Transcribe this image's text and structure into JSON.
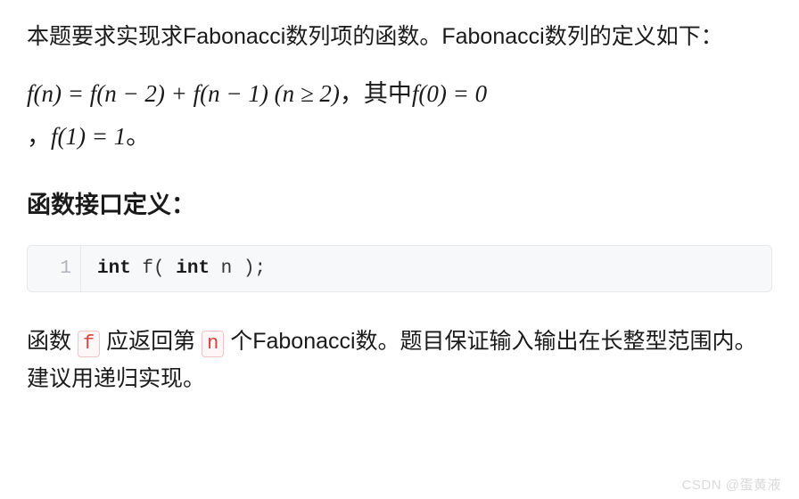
{
  "intro": "本题要求实现求Fabonacci数列项的函数。Fabonacci数列的定义如下：",
  "formula": {
    "line1_a": "f(n) = f(n − 2) + f(n − 1) (n ≥ 2)",
    "line1_b": "，其中",
    "line1_c": "f(0) = 0",
    "line2_a": "，",
    "line2_b": "f(1) = 1",
    "line2_c": "。"
  },
  "heading": "函数接口定义：",
  "code": {
    "lineno": "1",
    "kw_int1": "int",
    "fn": " f( ",
    "kw_int2": "int",
    "rest": " n );"
  },
  "desc": {
    "p1": "函数 ",
    "code_f": "f",
    "p2": " 应返回第 ",
    "code_n": "n",
    "p3": " 个Fabonacci数。题目保证输入输出在长整型范围内。建议用递归实现。"
  },
  "watermark": "CSDN @蛋黄液"
}
